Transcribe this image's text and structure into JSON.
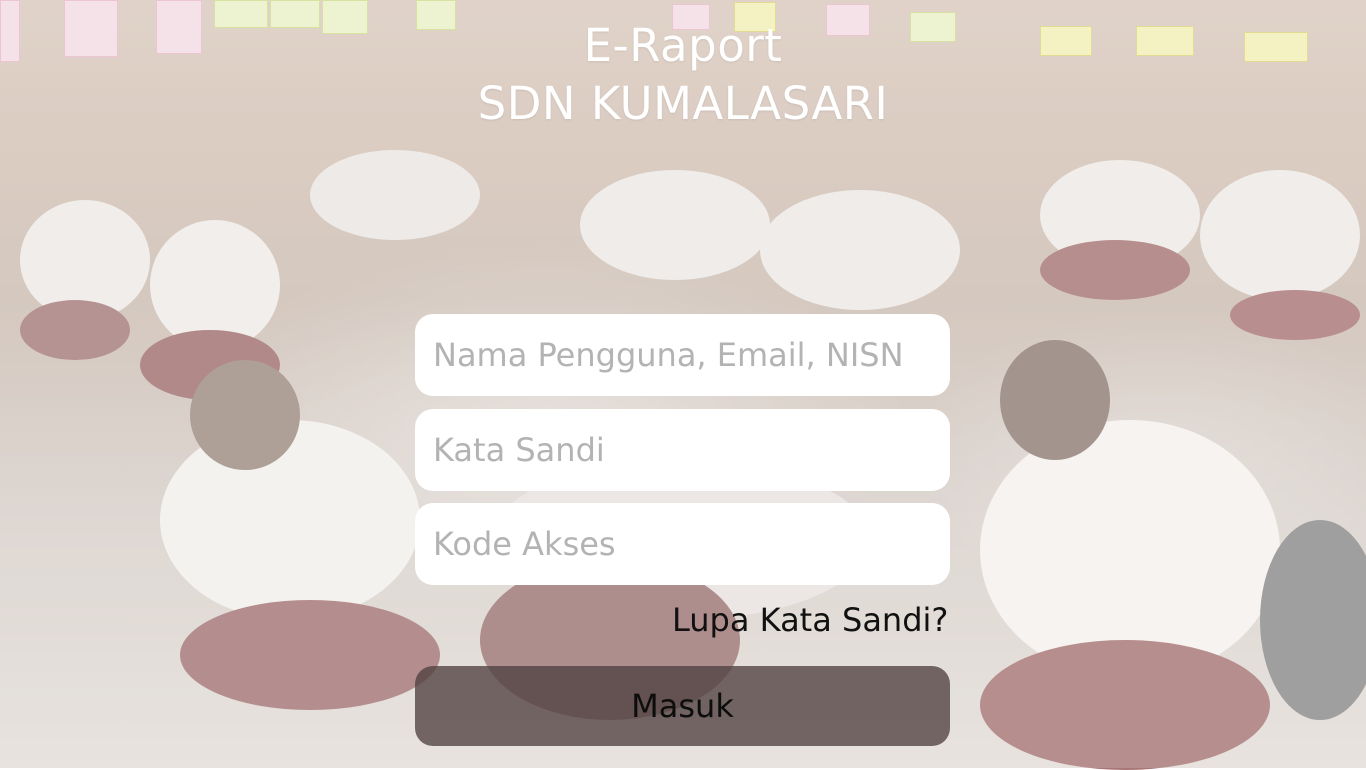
{
  "header": {
    "title_line1": "E-Raport",
    "title_line2": "SDN KUMALASARI"
  },
  "form": {
    "username_placeholder": "Nama Pengguna, Email, NISN",
    "username_value": "",
    "password_placeholder": "Kata Sandi",
    "password_value": "",
    "access_code_placeholder": "Kode Akses",
    "access_code_value": "",
    "forgot_password_label": "Lupa Kata Sandi?",
    "submit_label": "Masuk"
  },
  "colors": {
    "field_background": "#ffffff",
    "placeholder_text": "#b3b3b3",
    "submit_background": "#504040",
    "title_text": "#ffffff"
  }
}
